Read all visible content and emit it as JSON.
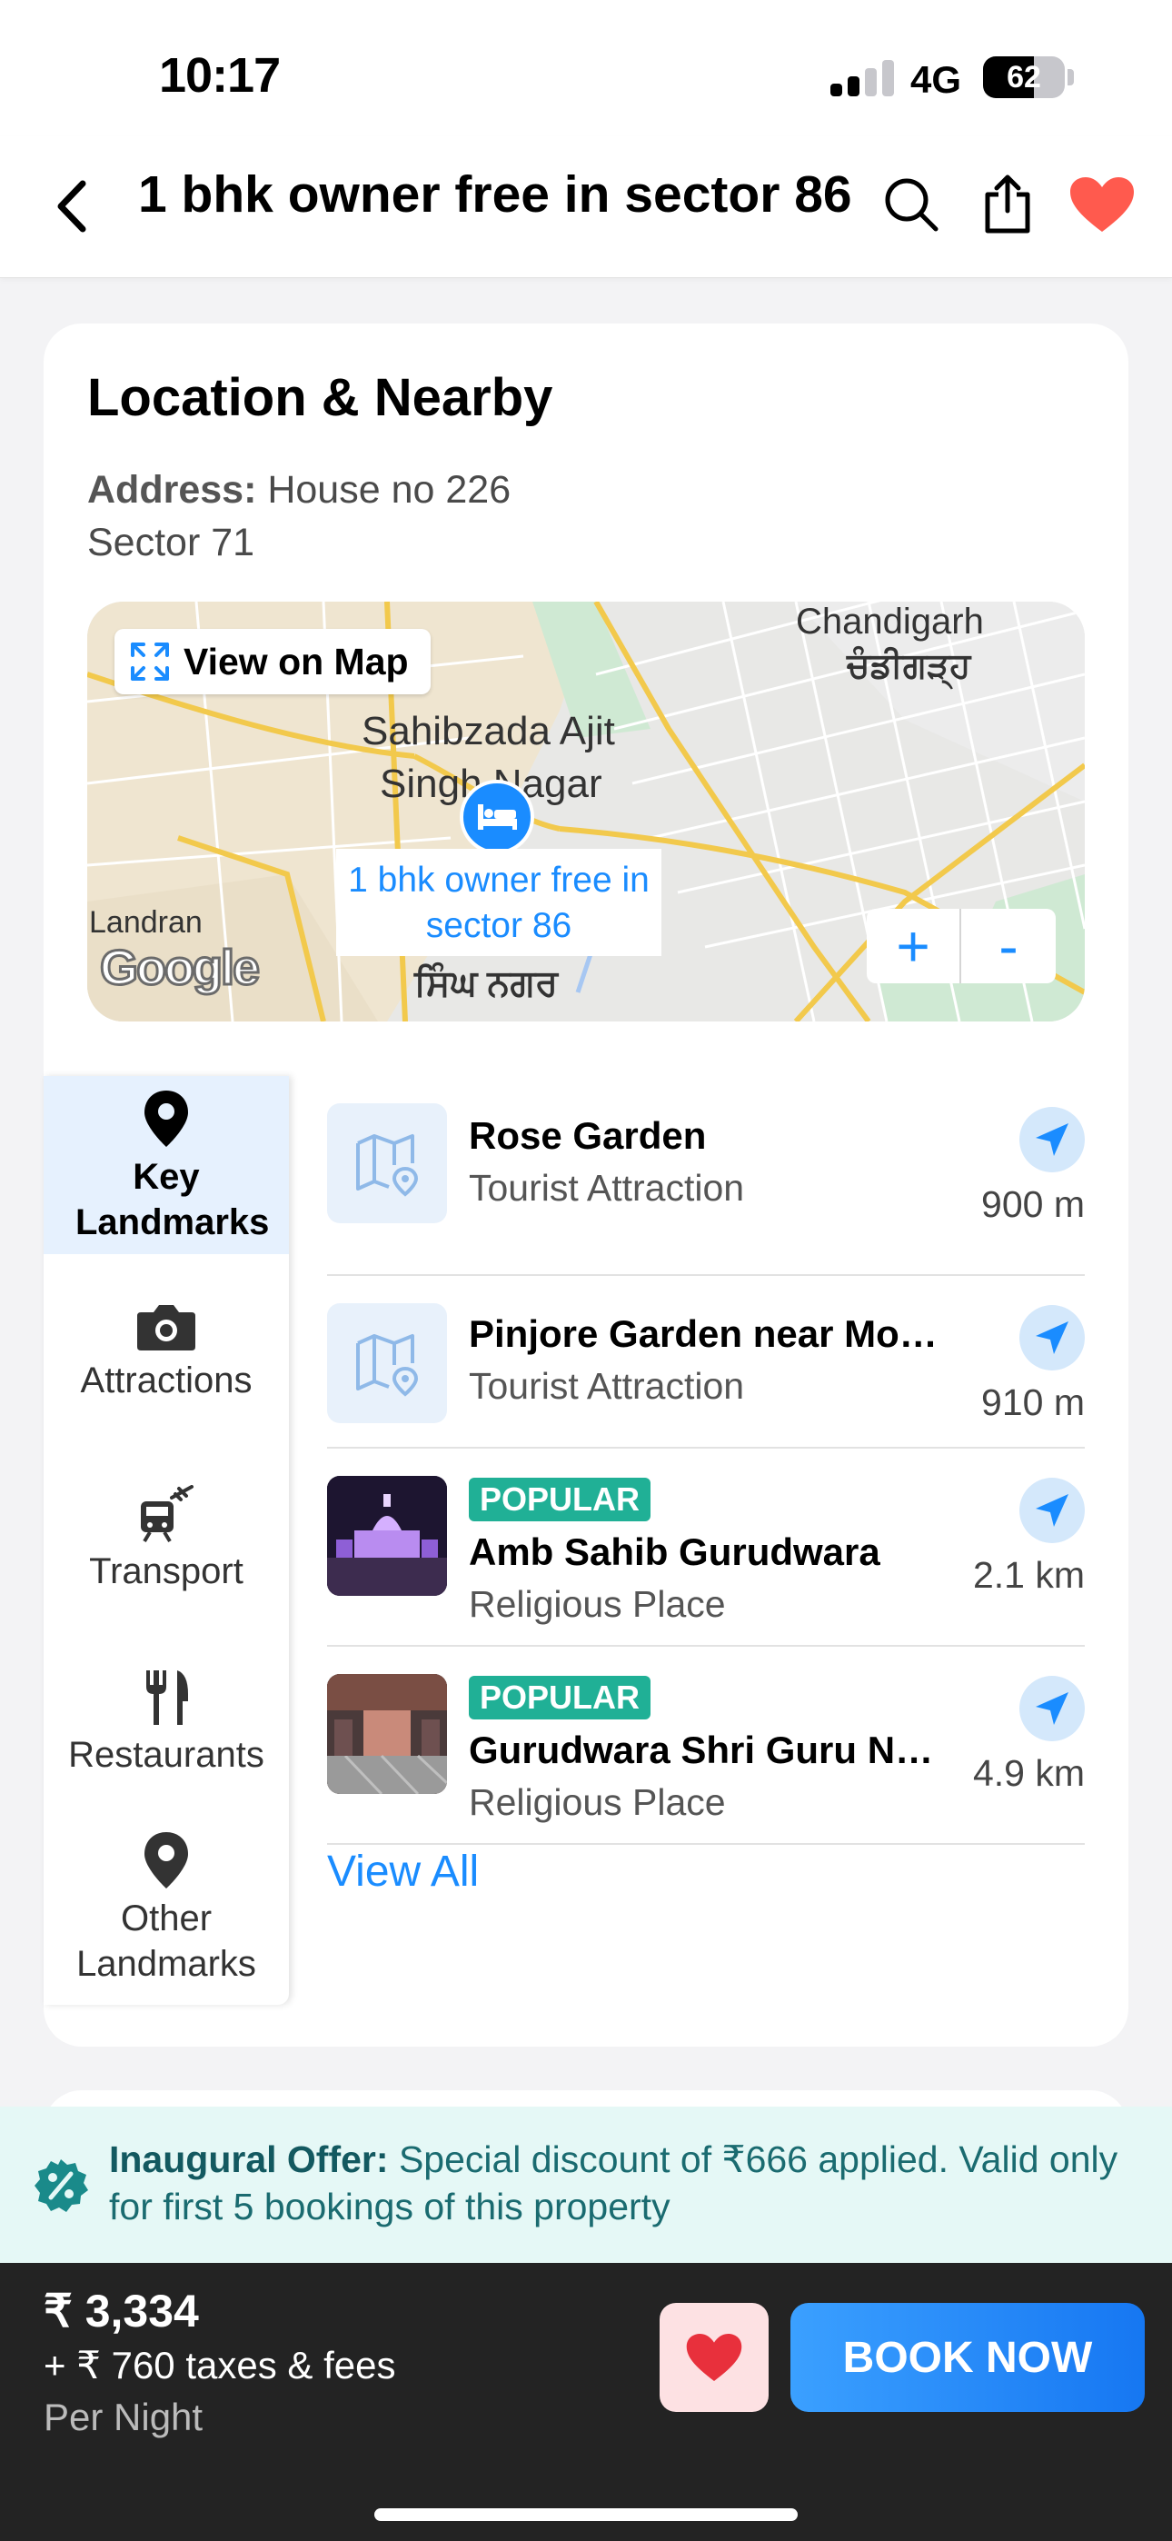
{
  "status_bar": {
    "time": "10:17",
    "network": "4G",
    "battery": "62",
    "battery_level_percent": 62
  },
  "header": {
    "title": "1 bhk owner free in sector 86"
  },
  "location": {
    "section_title": "Location & Nearby",
    "address_label": "Address:",
    "address_line1": "House no 226",
    "address_line2": "Sector 71"
  },
  "map": {
    "view_on_map": "View on Map",
    "city_en": "Chandigarh",
    "city_pa": "ਚੰਡੀਗੜ੍ਹ",
    "area_line1": "Sahibzada Ajit",
    "area_line2": "Singh Nagar",
    "area_pa": "ਸਿੰਘ ਨਗਰ",
    "village": "Landran",
    "pin_label": "1 bhk owner free in sector 86",
    "google": "Google",
    "zoom_in": "+",
    "zoom_out": "-"
  },
  "tabs": [
    {
      "label": "Key Landmarks",
      "icon": "location-pin-icon",
      "active": true
    },
    {
      "label": "Attractions",
      "icon": "camera-icon",
      "active": false
    },
    {
      "label": "Transport",
      "icon": "train-plane-icon",
      "active": false
    },
    {
      "label": "Restaurants",
      "icon": "fork-knife-icon",
      "active": false
    },
    {
      "label": "Other Landmarks",
      "icon": "location-pin-icon",
      "active": false
    }
  ],
  "landmarks": [
    {
      "name": "Rose Garden",
      "category": "Tourist Attraction",
      "distance": "900 m",
      "badge": ""
    },
    {
      "name": "Pinjore Garden near Mohali",
      "category": "Tourist Attraction",
      "distance": "910 m",
      "badge": ""
    },
    {
      "name": "Amb Sahib Gurudwara",
      "category": "Religious Place",
      "distance": "2.1 km",
      "badge": "POPULAR"
    },
    {
      "name": "Gurudwara Shri Guru Nan...",
      "category": "Religious Place",
      "distance": "4.9 km",
      "badge": "POPULAR"
    }
  ],
  "view_all": "View All",
  "offer": {
    "label": "Inaugural Offer:",
    "text": "Special discount of ₹666 applied. Valid only for first 5 bookings of this property"
  },
  "booking": {
    "price": "₹ 3,334",
    "taxes": "+ ₹ 760 taxes & fees",
    "per_night": "Per Night",
    "book_now": "BOOK NOW"
  },
  "colors": {
    "accent": "#1a8cff",
    "badge": "#20b096",
    "favorite": "#ff4d4d"
  }
}
